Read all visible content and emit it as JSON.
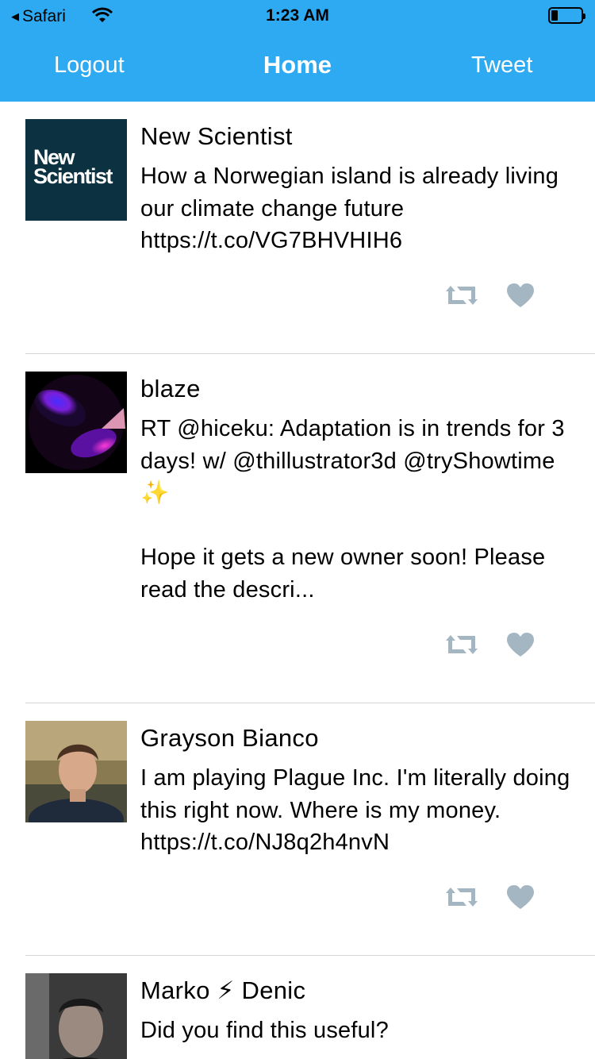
{
  "status_bar": {
    "back_app": "Safari",
    "time": "1:23 AM"
  },
  "nav": {
    "left_button": "Logout",
    "title": "Home",
    "right_button": "Tweet"
  },
  "colors": {
    "header": "#2daaf2",
    "action_icon": "#a5b6c3",
    "separator": "#d8d8d8"
  },
  "tweets": [
    {
      "name": "New Scientist",
      "avatar_text": "New Scientist",
      "text": "How a Norwegian island is already living our climate change future https://t.co/VG7BHVHIH6"
    },
    {
      "name": "blaze",
      "text": "RT @hiceku: Adaptation is in trends for 3 days! w/ @thillustrator3d @tryShowtime ✨\n\nHope it gets a new owner soon! Please read the descri..."
    },
    {
      "name": "Grayson Bianco",
      "text": "I am playing Plague Inc. I'm literally doing this right now. Where is my money. https://t.co/NJ8q2h4nvN"
    },
    {
      "name": "Marko ⚡ Denic",
      "text": "Did you find this useful?"
    }
  ],
  "icons": {
    "retweet": "retweet-icon",
    "like": "heart-icon"
  }
}
